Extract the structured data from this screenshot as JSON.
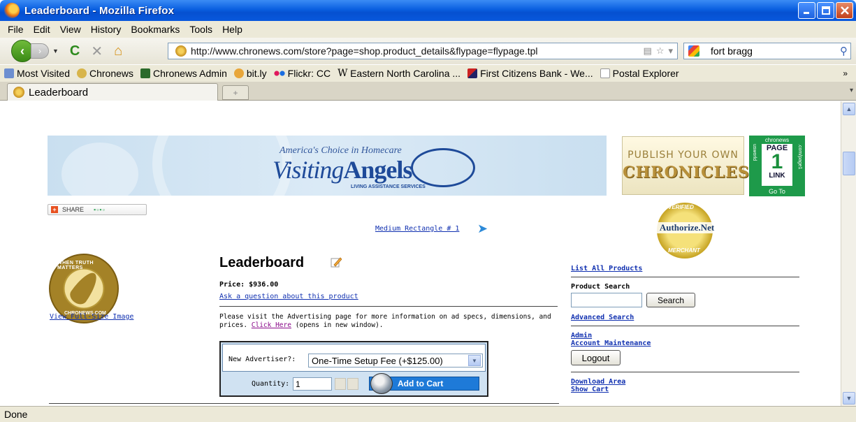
{
  "window": {
    "title": "Leaderboard - Mozilla Firefox"
  },
  "menubar": {
    "items": [
      "File",
      "Edit",
      "View",
      "History",
      "Bookmarks",
      "Tools",
      "Help"
    ]
  },
  "navbar": {
    "url": "http://www.chronews.com/store?page=shop.product_details&flypage=flypage.tpl",
    "search_value": "fort bragg"
  },
  "bookmarks": {
    "items": [
      "Most Visited",
      "Chronews",
      "Chronews Admin",
      "bit.ly",
      "Flickr: CC",
      "Eastern North Carolina ...",
      "First Citizens Bank - We...",
      "Postal Explorer"
    ],
    "more": "»"
  },
  "tabs": {
    "active": "Leaderboard"
  },
  "status": {
    "text": "Done"
  },
  "ads": {
    "banner_tagline": "America's Choice in Homecare",
    "banner_brand_a": "Visiting",
    "banner_brand_b": "Angels",
    "banner_sub": "LIVING ASSISTANCE SERVICES",
    "publish_line1": "PUBLISH YOUR OWN",
    "publish_line2": "CHRONICLES",
    "page1_top": "chronews",
    "page1_page": "PAGE",
    "page1_num": "1",
    "page1_link": "LINK",
    "page1_go": "Go To",
    "page1_left": "usworld",
    "page1_right": ".com/page1",
    "authnet_name": "Authorize.Net",
    "authnet_top": "VERIFIED",
    "authnet_bottom": "MERCHANT"
  },
  "share": {
    "label": "SHARE"
  },
  "medium_rect": {
    "label": "Medium Rectangle # 1"
  },
  "product": {
    "image_top_text": "WHEN TRUTH MATTERS",
    "image_bottom_text": "CHRONEWS.COM",
    "full_size": "View Full-Size Image",
    "title": "Leaderboard",
    "price": "Price: $936.00",
    "ask": "Ask a question about this product",
    "desc_before": "Please visit the Advertising page for more information on ad specs, dimensions, and prices. ",
    "desc_link": "Click Here",
    "desc_after": " (opens in new window).",
    "adv_label": "New Advertiser?:",
    "adv_option": "One-Time Setup Fee (+$125.00)",
    "qty_label": "Quantity:",
    "qty_value": "1",
    "add_to_cart": "Add to Cart"
  },
  "sidebar": {
    "list_all": "List All Products",
    "product_search": "Product Search",
    "search_btn": "Search",
    "advanced": "Advanced Search",
    "admin": "Admin",
    "account": "Account Maintenance",
    "logout": "Logout",
    "download": "Download Area",
    "show_cart": "Show Cart"
  },
  "colors": {
    "titlebar": "#0a5fe0",
    "link": "#1030b0",
    "cart_button": "#1e7ad8"
  }
}
